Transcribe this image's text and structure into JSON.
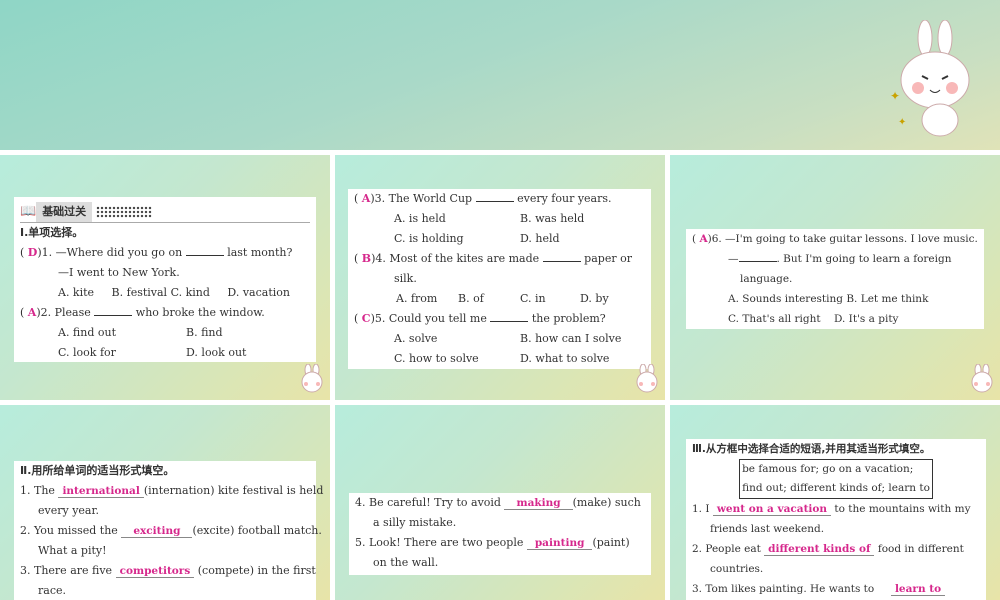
{
  "section1": {
    "header": "基础过关",
    "title": "Ⅰ.单项选择。",
    "q1": {
      "ans": "D",
      "num": ")1. —Where did you go on",
      "rest": "last month?",
      "line2": "—I went to New York.",
      "opts": [
        "A. kite",
        "B. festival",
        "C. kind",
        "D. vacation"
      ]
    },
    "q2": {
      "ans": "A",
      "num": ")2. Please",
      "rest": "who broke the window.",
      "opts": [
        "A. find out",
        "B. find",
        "C. look for",
        "D. look out"
      ]
    }
  },
  "section2": {
    "q3": {
      "ans": "A",
      "num": ")3. The World Cup",
      "rest": "every four years.",
      "opts": [
        "A. is held",
        "B. was held",
        "C. is holding",
        "D. held"
      ]
    },
    "q4": {
      "ans": "B",
      "num": ")4. Most of the kites are made",
      "rest": "paper or",
      "line2": "silk.",
      "opts": [
        "A. from",
        "B. of",
        "C. in",
        "D. by"
      ]
    },
    "q5": {
      "ans": "C",
      "num": ")5. Could you tell me",
      "rest": "the problem?",
      "opts": [
        "A. solve",
        "B. how can I solve",
        "C. how to solve",
        "D. what to solve"
      ]
    }
  },
  "section3": {
    "q6": {
      "ans": "A",
      "num": ")6. —I'm going to take guitar lessons. I love music.",
      "line2a": "—",
      "line2b": ". But I'm going to learn a foreign",
      "line3": "language.",
      "opts": [
        "A. Sounds interesting",
        "B. Let me think",
        "C. That's all right",
        "D. It's a pity"
      ]
    }
  },
  "section4": {
    "title": "Ⅱ.用所给单词的适当形式填空。",
    "items": [
      {
        "pre": "1. The",
        "fill": "international",
        "post": "(internation) kite festival is held",
        "line2": "every year."
      },
      {
        "pre": "2. You missed the",
        "fill": "exciting",
        "post": "(excite) football match.",
        "line2": "What a pity!"
      },
      {
        "pre": "3. There are five",
        "fill": "competitors",
        "post": "(compete) in the first",
        "line2": "race."
      }
    ]
  },
  "section5": {
    "items": [
      {
        "pre": "4. Be careful! Try to avoid",
        "fill": "making",
        "post": "(make) such",
        "line2": "a silly mistake."
      },
      {
        "pre": "5. Look! There are two people",
        "fill": "painting",
        "post": "(paint)",
        "line2": "on the wall."
      }
    ]
  },
  "section6": {
    "title": "Ⅲ.从方框中选择合适的短语,并用其适当形式填空。",
    "box1": "be famous for; go on a vacation;",
    "box2": "find out; different kinds of; learn to",
    "items": [
      {
        "pre": "1. I",
        "fill": "went on a vacation",
        "post": "to the mountains with my",
        "line2": "friends last weekend."
      },
      {
        "pre": "2. People eat",
        "fill": "different kinds of",
        "post": "food in different",
        "line2": "countries."
      },
      {
        "pre": "3. Tom likes painting. He wants to",
        "fill": "learn to",
        "post": ""
      }
    ]
  }
}
